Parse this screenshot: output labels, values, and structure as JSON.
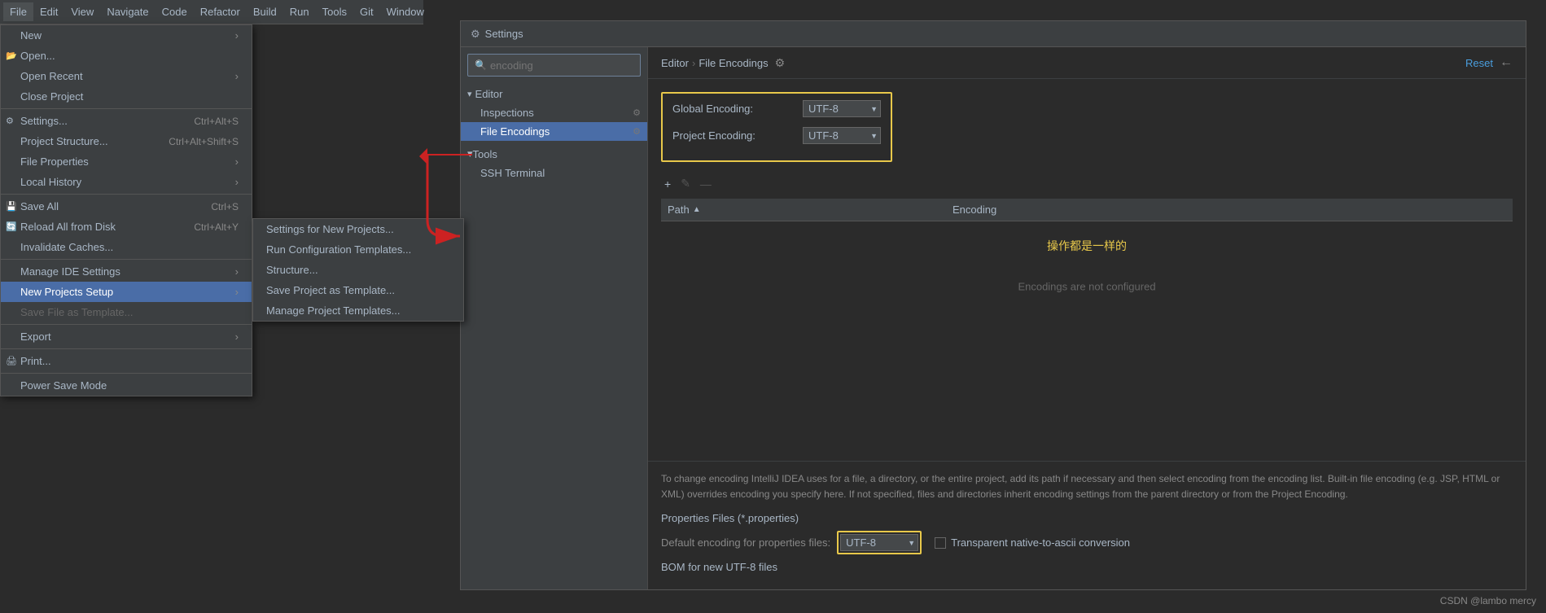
{
  "menubar": {
    "items": [
      "File",
      "Edit",
      "View",
      "Navigate",
      "Code",
      "Refactor",
      "Build",
      "Run",
      "Tools",
      "Git",
      "Window"
    ]
  },
  "file_menu": {
    "items": [
      {
        "label": "New",
        "shortcut": "",
        "arrow": true,
        "icon": "",
        "disabled": false
      },
      {
        "label": "Open...",
        "shortcut": "",
        "arrow": false,
        "icon": "📁",
        "disabled": false
      },
      {
        "label": "Open Recent",
        "shortcut": "",
        "arrow": true,
        "icon": "",
        "disabled": false
      },
      {
        "label": "Close Project",
        "shortcut": "",
        "arrow": false,
        "icon": "",
        "disabled": false
      },
      {
        "separator": true
      },
      {
        "label": "Settings...",
        "shortcut": "Ctrl+Alt+S",
        "arrow": false,
        "icon": "⚙",
        "disabled": false
      },
      {
        "label": "Project Structure...",
        "shortcut": "Ctrl+Alt+Shift+S",
        "arrow": false,
        "icon": "📐",
        "disabled": false
      },
      {
        "label": "File Properties",
        "shortcut": "",
        "arrow": true,
        "icon": "",
        "disabled": false
      },
      {
        "label": "Local History",
        "shortcut": "",
        "arrow": true,
        "icon": "",
        "disabled": false
      },
      {
        "separator": true
      },
      {
        "label": "Save All",
        "shortcut": "Ctrl+S",
        "arrow": false,
        "icon": "💾",
        "disabled": false
      },
      {
        "label": "Reload All from Disk",
        "shortcut": "Ctrl+Alt+Y",
        "arrow": false,
        "icon": "🔄",
        "disabled": false
      },
      {
        "label": "Invalidate Caches...",
        "shortcut": "",
        "arrow": false,
        "icon": "",
        "disabled": false
      },
      {
        "separator": true
      },
      {
        "label": "Manage IDE Settings",
        "shortcut": "",
        "arrow": true,
        "icon": "",
        "disabled": false
      },
      {
        "label": "New Projects Setup",
        "shortcut": "",
        "arrow": true,
        "icon": "",
        "disabled": false,
        "highlighted": true
      },
      {
        "label": "Save File as Template...",
        "shortcut": "",
        "arrow": false,
        "icon": "",
        "disabled": true
      },
      {
        "separator": true
      },
      {
        "label": "Export",
        "shortcut": "",
        "arrow": true,
        "icon": "",
        "disabled": false
      },
      {
        "separator": true
      },
      {
        "label": "Print...",
        "shortcut": "",
        "arrow": false,
        "icon": "🖨",
        "disabled": false
      },
      {
        "separator": true
      },
      {
        "label": "Power Save Mode",
        "shortcut": "",
        "arrow": false,
        "icon": "",
        "disabled": false
      }
    ]
  },
  "submenu": {
    "items": [
      {
        "label": "Settings for New Projects..."
      },
      {
        "label": "Run Configuration Templates..."
      },
      {
        "label": "Structure..."
      },
      {
        "label": "Save Project as Template..."
      },
      {
        "label": "Manage Project Templates..."
      }
    ]
  },
  "settings": {
    "title": "Settings",
    "search_placeholder": "encoding",
    "breadcrumb": {
      "parts": [
        "Editor",
        "File Encodings"
      ],
      "separator": "›"
    },
    "reset_label": "Reset",
    "back_icon": "←",
    "sidebar": {
      "editor_section": "▾ Editor",
      "inspections_item": "Inspections",
      "file_encodings_item": "File Encodings",
      "tools_section": "▾ Tools",
      "ssh_terminal_item": "SSH Terminal"
    },
    "global_encoding_label": "Global Encoding:",
    "global_encoding_value": "UTF-8",
    "project_encoding_label": "Project Encoding:",
    "project_encoding_value": "UTF-8",
    "table": {
      "path_col": "Path",
      "encoding_col": "Encoding",
      "empty_text": "Encodings are not configured"
    },
    "chinese_note": "操作都是一样的",
    "bottom_description": "To change encoding IntelliJ IDEA uses for a file, a directory, or the entire project, add its path if necessary and then select encoding from the encoding list. Built-in file encoding (e.g. JSP, HTML or XML) overrides encoding you specify here. If not specified, files and directories inherit encoding settings from the parent directory or from the Project Encoding.",
    "properties_section_title": "Properties Files (*.properties)",
    "default_encoding_label": "Default encoding for properties files:",
    "default_encoding_value": "UTF-8",
    "transparent_label": "Transparent native-to-ascii conversion",
    "bom_label": "BOM for new UTF-8 files",
    "watermark": "CSDN @lambo mercy",
    "toolbar": {
      "add": "+",
      "edit": "✎",
      "remove": "—"
    }
  }
}
